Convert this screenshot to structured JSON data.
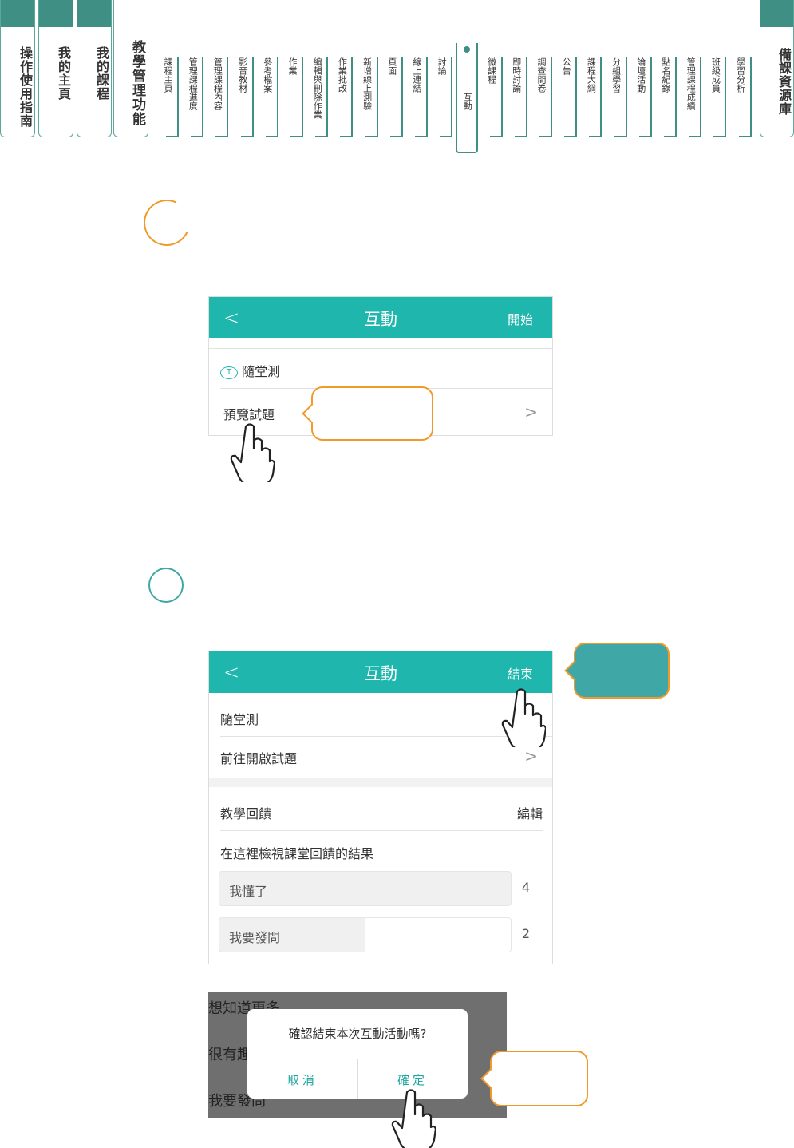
{
  "nav": {
    "main_tabs": [
      {
        "label": "操作使用指南"
      },
      {
        "label": "我的主頁"
      },
      {
        "label": "我的課程"
      },
      {
        "label": "教學管理功能"
      }
    ],
    "right_tab": {
      "label": "備課資源庫"
    },
    "sub_tabs": [
      "課程主頁",
      "管理課程進度",
      "管理課程內容",
      "影音教材",
      "參考檔案",
      "作業",
      "編輯與刪除作業",
      "作業批改",
      "新增線上測驗",
      "頁面",
      "線上連結",
      "討論",
      "互動",
      "微課程",
      "即時討論",
      "調查問卷",
      "公告",
      "課程大綱",
      "分組學習",
      "論壇活動",
      "點名紀錄",
      "管理課程成績",
      "班級成員",
      "學習分析"
    ],
    "active_sub_tab": "互動"
  },
  "panel1": {
    "title": "互動",
    "back": "<",
    "action": "開始",
    "quiz_label": "隨堂測",
    "preview_label": "預覽試題",
    "chevron": ">"
  },
  "panel2": {
    "title": "互動",
    "back": "<",
    "action": "結束",
    "quiz_label": "隨堂測",
    "open_label": "前往開啟試題",
    "chevron": ">",
    "feedback_title": "教學回饋",
    "edit_label": "編輯",
    "feedback_hint": "在這裡檢視課堂回饋的結果",
    "feedback_items": [
      {
        "label": "我懂了",
        "count": "4"
      },
      {
        "label": "我要發問",
        "count": "2"
      }
    ]
  },
  "modal": {
    "bg_rows": [
      "想知道更多",
      "很有趣",
      "我要發問"
    ],
    "question": "確認結束本次互動活動嗎?",
    "cancel": "取消",
    "confirm": "確定"
  },
  "colors": {
    "teal_bar": "#1fb6ad",
    "nav_green": "#3f8f84",
    "callout_orange": "#f19a2a",
    "callout_teal": "#3fa7a5"
  }
}
